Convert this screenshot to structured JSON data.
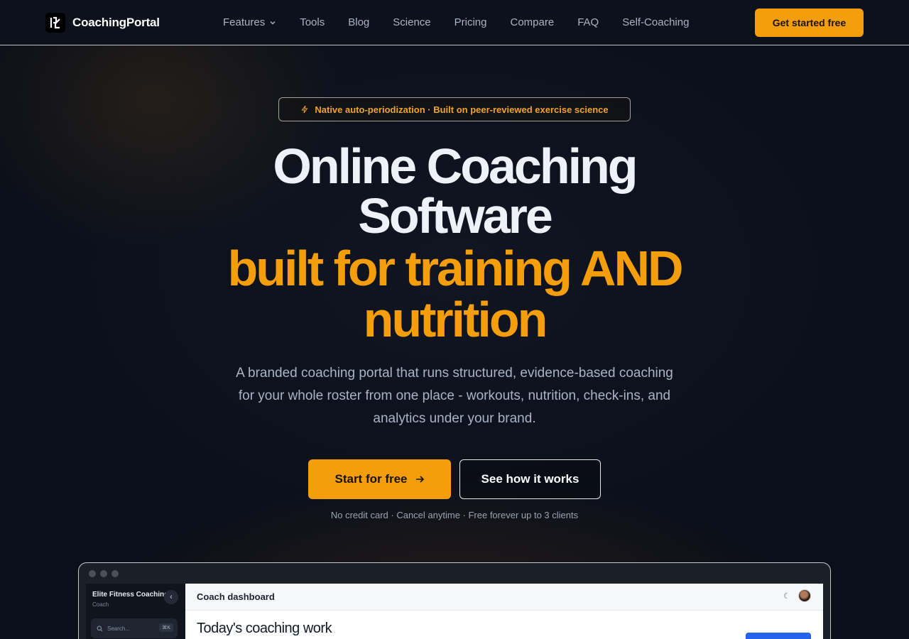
{
  "nav": {
    "brand": "CoachingPortal",
    "links": [
      {
        "label": "Features",
        "has_dropdown": true
      },
      {
        "label": "Tools"
      },
      {
        "label": "Blog"
      },
      {
        "label": "Science"
      },
      {
        "label": "Pricing"
      },
      {
        "label": "Compare"
      },
      {
        "label": "FAQ"
      },
      {
        "label": "Self-Coaching"
      }
    ],
    "cta": "Get started free"
  },
  "hero": {
    "badge": "Native auto-periodization · Built on peer-reviewed exercise science",
    "title_line1": "Online Coaching",
    "title_line2": "Software",
    "title_line3": "built for training AND",
    "title_line4": "nutrition",
    "subtitle": "A branded coaching portal that runs structured, evidence-based coaching for your whole roster from one place - workouts, nutrition, check-ins, and analytics under your brand.",
    "primary_button": "Start for free",
    "secondary_button": "See how it works",
    "fineprint": "No credit card · Cancel anytime · Free forever up to 3 clients"
  },
  "preview": {
    "org_name": "Elite Fitness Coaching",
    "role": "Coach",
    "search_placeholder": "Search...",
    "search_shortcut": "⌘K",
    "header_title": "Coach dashboard",
    "page_heading": "Today's coaching work"
  },
  "colors": {
    "accent": "#f59e0b",
    "background": "#0b0f19",
    "preview_button": "#2563eb"
  }
}
